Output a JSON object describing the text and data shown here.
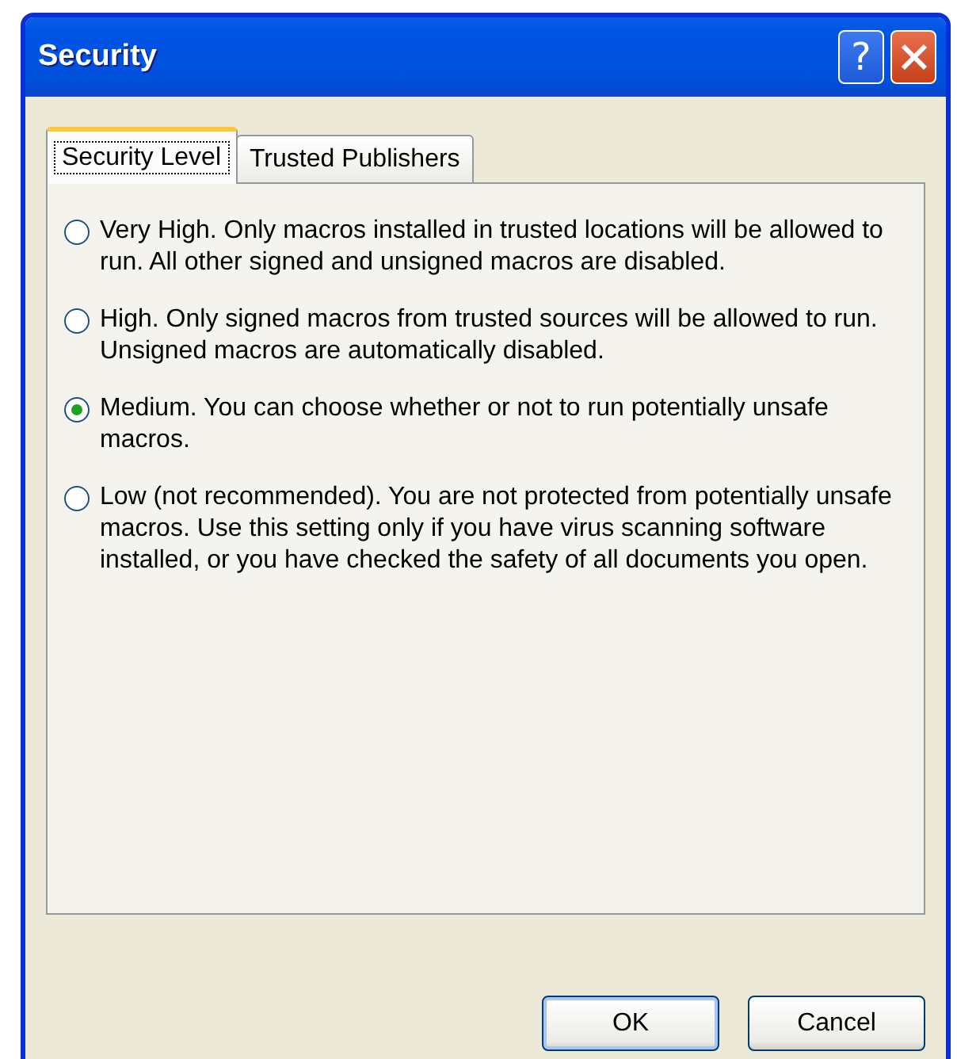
{
  "window": {
    "title": "Security"
  },
  "title_buttons": [
    {
      "kind": "help",
      "label": "?"
    },
    {
      "kind": "close"
    }
  ],
  "tabs": [
    {
      "label": "Security Level",
      "selected": true
    },
    {
      "label": "Trusted Publishers",
      "selected": false
    }
  ],
  "options": [
    {
      "label": "Very High. Only macros installed in trusted locations will be allowed to run. All other signed and unsigned macros are disabled.",
      "selected": false
    },
    {
      "label": "High. Only signed macros from trusted sources will be allowed to run. Unsigned macros are automatically disabled.",
      "selected": false
    },
    {
      "label": "Medium. You can choose whether or not to run potentially unsafe macros.",
      "selected": true
    },
    {
      "label": "Low (not recommended). You are not protected from potentially unsafe macros. Use this setting only if you have virus scanning software installed, or you have checked the safety of all documents you open.",
      "selected": false
    }
  ],
  "buttons": [
    {
      "label": "OK",
      "default": true
    },
    {
      "label": "Cancel",
      "default": false
    }
  ]
}
